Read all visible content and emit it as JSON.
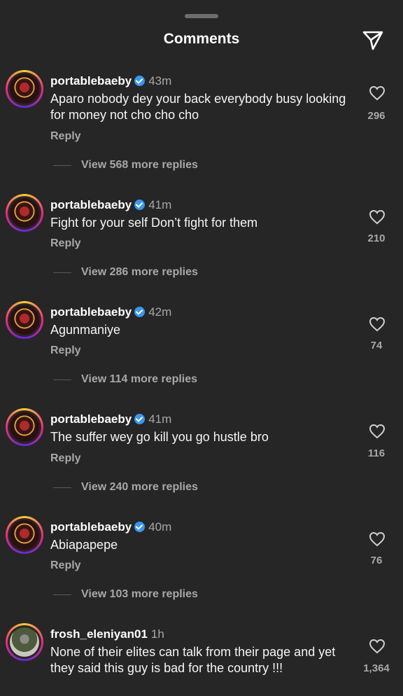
{
  "header": {
    "title": "Comments",
    "share_icon": "send-icon"
  },
  "comments": [
    {
      "username": "portablebaeby",
      "verified": true,
      "time": "43m",
      "text": "Aparo nobody dey your back everybody busy looking for money not cho cho cho",
      "reply_label": "Reply",
      "view_replies": "View 568 more replies",
      "likes": "296"
    },
    {
      "username": "portablebaeby",
      "verified": true,
      "time": "41m",
      "text": "Fight for your self Don’t fight for them",
      "reply_label": "Reply",
      "view_replies": "View 286 more replies",
      "likes": "210"
    },
    {
      "username": "portablebaeby",
      "verified": true,
      "time": "42m",
      "text": "Agunmaniye",
      "reply_label": "Reply",
      "view_replies": "View 114 more replies",
      "likes": "74"
    },
    {
      "username": "portablebaeby",
      "verified": true,
      "time": "41m",
      "text": "The suffer wey go kill you go hustle bro",
      "reply_label": "Reply",
      "view_replies": "View 240 more replies",
      "likes": "116"
    },
    {
      "username": "portablebaeby",
      "verified": true,
      "time": "40m",
      "text": "Abiapapepe",
      "reply_label": "Reply",
      "view_replies": "View 103 more replies",
      "likes": "76"
    },
    {
      "username": "frosh_eleniyan01",
      "verified": false,
      "time": "1h",
      "text": "None of their elites can talk from their page and yet they said this guy is bad for the country !!!",
      "likes": "1,364"
    }
  ]
}
